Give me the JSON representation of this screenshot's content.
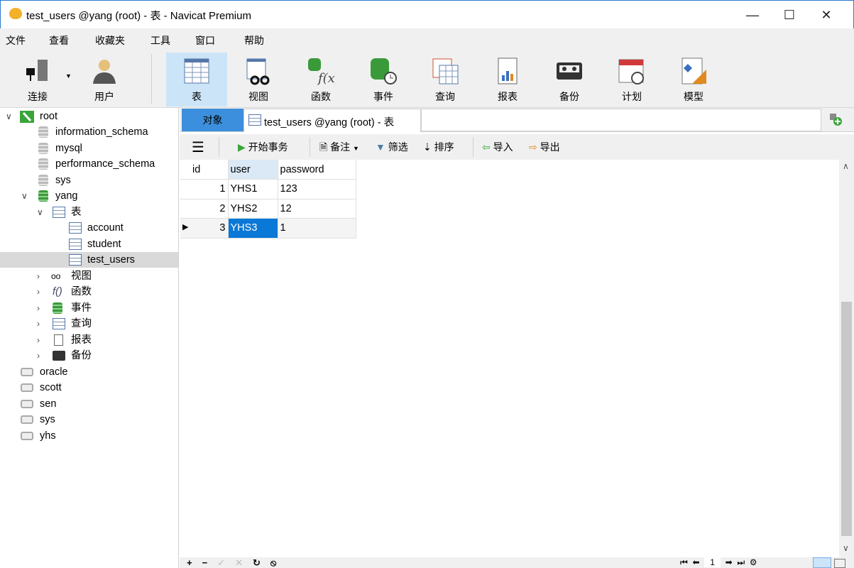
{
  "window": {
    "title": "test_users @yang (root) - 表 - Navicat Premium",
    "minimize": "—",
    "maximize": "☐",
    "close": "✕"
  },
  "menu": [
    "文件",
    "查看",
    "收藏夹",
    "工具",
    "窗口",
    "帮助"
  ],
  "toolbar": [
    {
      "label": "连接",
      "icon": "connection-icon"
    },
    {
      "label": "用户",
      "icon": "user-icon"
    },
    {
      "label": "表",
      "icon": "table-icon"
    },
    {
      "label": "视图",
      "icon": "view-icon"
    },
    {
      "label": "函数",
      "icon": "function-icon"
    },
    {
      "label": "事件",
      "icon": "event-icon"
    },
    {
      "label": "查询",
      "icon": "query-icon"
    },
    {
      "label": "报表",
      "icon": "report-icon"
    },
    {
      "label": "备份",
      "icon": "backup-icon"
    },
    {
      "label": "计划",
      "icon": "schedule-icon"
    },
    {
      "label": "模型",
      "icon": "model-icon"
    }
  ],
  "tree": {
    "root": "root",
    "databases": [
      "information_schema",
      "mysql",
      "performance_schema",
      "sys"
    ],
    "yang": "yang",
    "tables_node": "表",
    "tables": [
      "account",
      "student",
      "test_users"
    ],
    "yang_children": [
      "视图",
      "函数",
      "事件",
      "查询",
      "报表",
      "备份"
    ],
    "connections": [
      "oracle",
      "scott",
      "sen",
      "sys",
      "yhs"
    ]
  },
  "tabs": {
    "objects": "对象",
    "active": "test_users @yang (root) - 表"
  },
  "objtool": {
    "begin_tx": "开始事务",
    "comment": "备注",
    "filter": "筛选",
    "sort": "排序",
    "import": "导入",
    "export": "导出"
  },
  "grid": {
    "columns": [
      "id",
      "user",
      "password"
    ],
    "rows": [
      [
        "1",
        "YHS1",
        "123"
      ],
      [
        "2",
        "YHS2",
        "12"
      ],
      [
        "3",
        "YHS3",
        "1"
      ]
    ]
  },
  "pager": {
    "page": "1"
  }
}
